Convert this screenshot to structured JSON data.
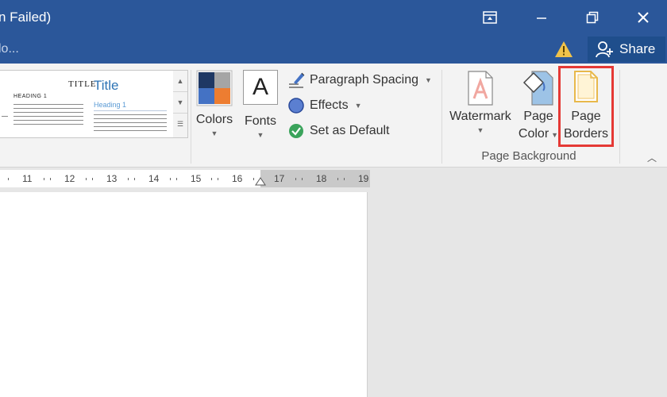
{
  "titlebar": {
    "title": "n Failed)"
  },
  "sharebar": {
    "tell_me": "lo...",
    "share_label": "Share"
  },
  "gallery": {
    "title_small": "TITLE",
    "title_big": "Title",
    "heading_small": "HEADING 1",
    "heading_blue": "Heading 1"
  },
  "ribbon": {
    "colors_label": "Colors",
    "fonts_label": "Fonts",
    "fonts_glyph": "A",
    "paragraph_spacing_label": "Paragraph Spacing",
    "effects_label": "Effects",
    "set_default_label": "Set as Default",
    "watermark_label": "Watermark",
    "page_color_line1": "Page",
    "page_color_line2": "Color",
    "page_borders_line1": "Page",
    "page_borders_line2": "Borders",
    "group_label": "Page Background"
  },
  "ruler": {
    "numbers": [
      "11",
      "12",
      "13",
      "14",
      "15",
      "16",
      "17",
      "18",
      "19"
    ]
  },
  "colors": {
    "titlebar_bg": "#2b579a",
    "highlight": "#e53935",
    "swatch_dark": "#1f3864",
    "swatch_gray": "#a5a5a5",
    "swatch_blue": "#4472c4",
    "swatch_orange": "#ed7d31"
  }
}
